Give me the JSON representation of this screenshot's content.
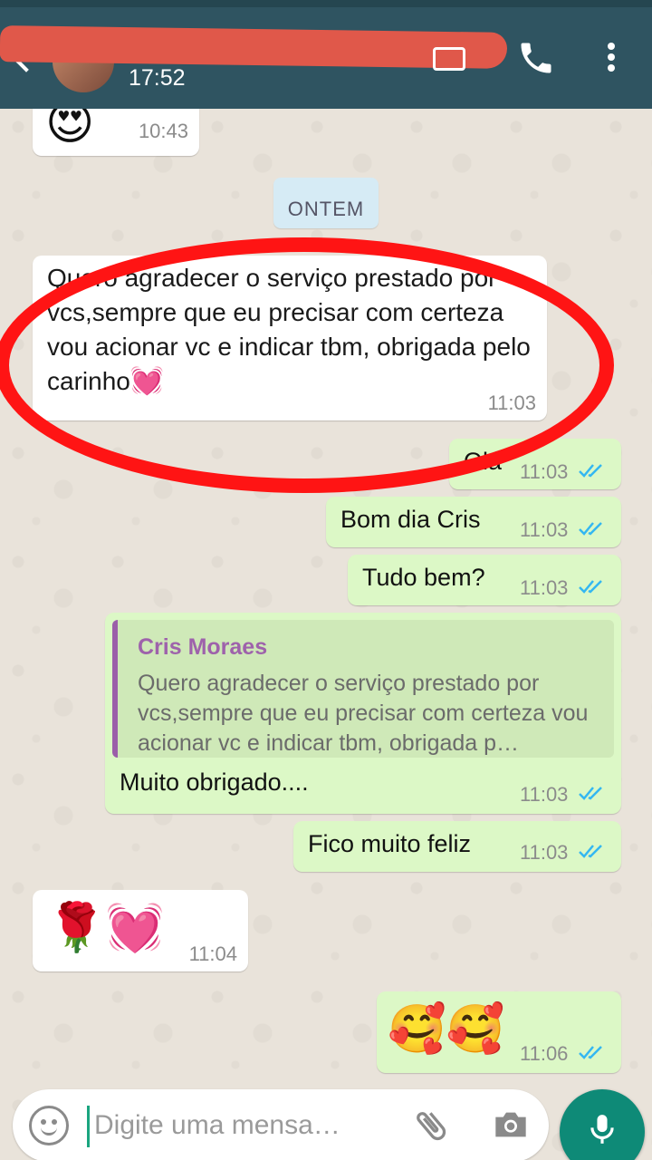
{
  "header": {
    "last_seen": "17:52"
  },
  "date_chip": "ONTEM",
  "messages": [
    {
      "type": "in",
      "emoji": "😍",
      "time": "10:43"
    },
    {
      "type": "in",
      "text": "Quero agradecer o serviço prestado por vcs,sempre que eu precisar com certeza vou acionar vc e indicar tbm, obrigada pelo carinho",
      "emoji": "💓",
      "time": "11:03"
    },
    {
      "type": "out",
      "text": "Olá",
      "time": "11:03"
    },
    {
      "type": "out",
      "text": "Bom dia Cris",
      "time": "11:03"
    },
    {
      "type": "out",
      "text": "Tudo bem?",
      "time": "11:03"
    },
    {
      "type": "out",
      "quote_author": "Cris Moraes",
      "quote_text": "Quero agradecer o serviço prestado por vcs,sempre que eu precisar com certeza vou acionar vc e indicar tbm, obrigada p…",
      "text": "Muito obrigado....",
      "time": "11:03"
    },
    {
      "type": "out",
      "text": "Fico muito feliz",
      "time": "11:03"
    },
    {
      "type": "in",
      "emoji": "🌹💓",
      "time": "11:04"
    },
    {
      "type": "out",
      "emoji": "🥰🥰",
      "time": "11:06"
    }
  ],
  "input": {
    "placeholder": "Digite uma mensa…"
  },
  "colors": {
    "header": "#2f5461",
    "outgoing_bubble": "#dcf8c6",
    "incoming_bubble": "#ffffff",
    "read_ticks": "#34b7f1",
    "annotation": "#ff1414",
    "mic_button": "#0e8a77"
  },
  "icons": [
    "back-arrow-icon",
    "video-call-icon",
    "phone-icon",
    "more-vert-icon",
    "emoji-icon",
    "attach-icon",
    "camera-icon",
    "mic-icon",
    "double-check-icon"
  ]
}
